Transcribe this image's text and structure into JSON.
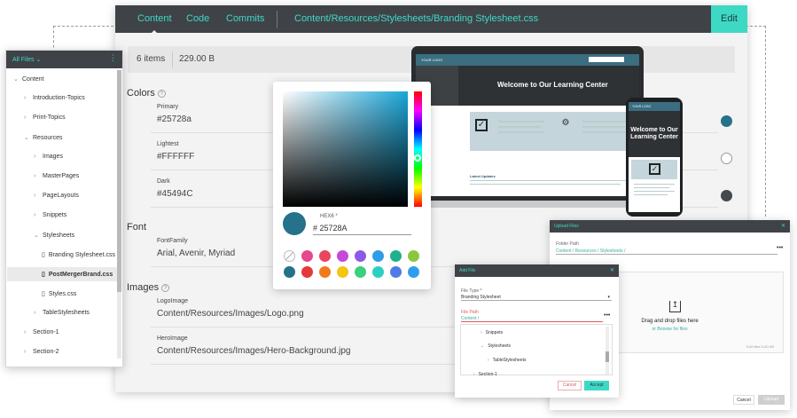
{
  "main": {
    "tabs": [
      "Content",
      "Code",
      "Commits"
    ],
    "path": "Content/Resources/Stylesheets/Branding Stylesheet.css",
    "edit_label": "Edit",
    "info": {
      "items": "6 items",
      "size": "229.00 B"
    },
    "colors": {
      "heading": "Colors",
      "primary_label": "Primary",
      "primary_value": "#25728a",
      "lightest_label": "Lightest",
      "lightest_value": "#FFFFFF",
      "dark_label": "Dark",
      "dark_value": "#45494C"
    },
    "font": {
      "heading": "Font",
      "family_label": "FontFamily",
      "family_value": "Arial, Avenir, Myriad"
    },
    "images": {
      "heading": "Images",
      "logo_label": "LogoImage",
      "logo_value": "Content/Resources/Images/Logo.png",
      "hero_label": "HeroImage",
      "hero_value": "Content/Resources/Images/Hero-Background.jpg"
    }
  },
  "sidebar": {
    "title": "All Files",
    "items": {
      "content": "Content",
      "intro": "Introduction-Topics",
      "print": "Print-Topics",
      "resources": "Resources",
      "images": "Images",
      "masterpages": "MasterPages",
      "pagelayouts": "PageLayouts",
      "snippets": "Snippets",
      "stylesheets": "Stylesheets",
      "branding": "Branding Stylesheet.css",
      "postmerger": "PostMergerBrand.css",
      "styles": "Styles.css",
      "tablestyles": "TableStylesheets",
      "section1": "Section-1",
      "section2": "Section-2"
    }
  },
  "picker": {
    "hex_label": "HEX6 *",
    "hex_value": "# 25728A",
    "palette": [
      "#ffffff",
      "#e6478f",
      "#e8465e",
      "#c549d6",
      "#8c5ae6",
      "#2f9de6",
      "#1fb08e",
      "#8cc63f",
      "#25728a",
      "#e23a3a",
      "#f07b1f",
      "#f4c514",
      "#3ccf7d",
      "#2ad0c0",
      "#4f7be6",
      "#2f9dee"
    ]
  },
  "laptop": {
    "logo": "YOUR LOGO",
    "hero_title": "Welcome to Our Learning Center",
    "updates": "Latest Updates"
  },
  "phone": {
    "logo": "YOUR LOGO",
    "hero_title": "Welcome to Our Learning Center"
  },
  "add_file": {
    "title": "Add File",
    "type_label": "File Type *",
    "type_value": "Branding Stylesheet",
    "path_label": "File Path",
    "path_value": "Content /",
    "list": [
      "Snippets",
      "Stylesheets",
      "TableStylesheets",
      "Section-1"
    ],
    "cancel": "Cancel",
    "accept": "Accept"
  },
  "upload": {
    "title": "Upload Files",
    "path_label": "Folder Path",
    "path_value": "Content / Resources / Stylesheets /",
    "drop_text": "Drag and drop files here",
    "browse_text": "or Browse for files",
    "size_text": "0.00 files    0.00 KB",
    "cancel": "Cancel",
    "upload": "Upload"
  },
  "colors": {
    "accent": "#3ed9c5",
    "primary": "#25728a",
    "dark": "#45494c",
    "bar": "#3f4347"
  }
}
